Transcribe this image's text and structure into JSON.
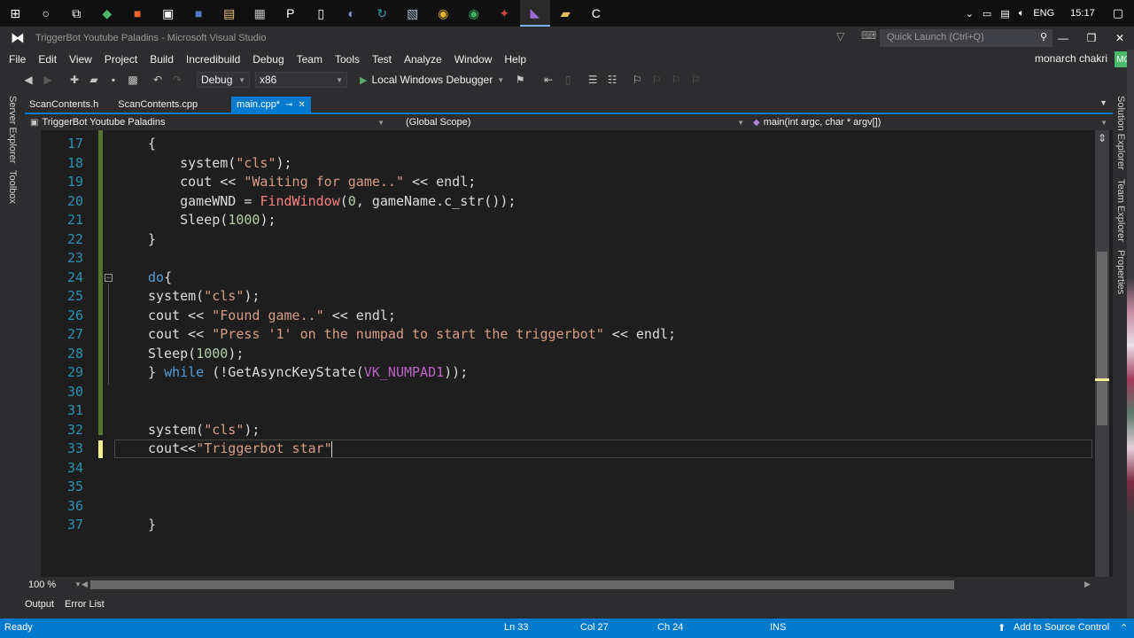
{
  "taskbar": {
    "time": "15:17",
    "language": "ENG",
    "apps": [
      {
        "icon": "windows-start-icon",
        "glyph": "⊞",
        "color": "#ffffff"
      },
      {
        "icon": "cortana-icon",
        "glyph": "○",
        "color": "#ffffff"
      },
      {
        "icon": "task-view-icon",
        "glyph": "⧉",
        "color": "#ffffff"
      },
      {
        "icon": "app-green-diamond-icon",
        "glyph": "◆",
        "color": "#4cb86c"
      },
      {
        "icon": "app-orange-icon",
        "glyph": "■",
        "color": "#e8672a"
      },
      {
        "icon": "store-icon",
        "glyph": "▣",
        "color": "#ffffff"
      },
      {
        "icon": "app-blue-icon",
        "glyph": "■",
        "color": "#5577cc"
      },
      {
        "icon": "app-image-icon",
        "glyph": "▤",
        "color": "#e8c070"
      },
      {
        "icon": "app-film-icon",
        "glyph": "▦",
        "color": "#c0c0c0"
      },
      {
        "icon": "app-p-icon",
        "glyph": "P",
        "color": "#ffffff"
      },
      {
        "icon": "app-doc-icon",
        "glyph": "▯",
        "color": "#ffffff"
      },
      {
        "icon": "app-disc-icon",
        "glyph": "◐",
        "color": "#8899cc"
      },
      {
        "icon": "app-refresh-icon",
        "glyph": "↻",
        "color": "#3aa0a0"
      },
      {
        "icon": "app-photos-icon",
        "glyph": "▧",
        "color": "#aabbcc"
      },
      {
        "icon": "chrome-icon",
        "glyph": "◉",
        "color": "#e0b030"
      },
      {
        "icon": "chrome-alt-icon",
        "glyph": "◉",
        "color": "#3ab060"
      },
      {
        "icon": "app-tool-icon",
        "glyph": "✦",
        "color": "#cc4444"
      },
      {
        "icon": "visual-studio-icon",
        "glyph": "◣",
        "color": "#9b6ad6"
      },
      {
        "icon": "file-explorer-icon",
        "glyph": "▰",
        "color": "#e8c060"
      },
      {
        "icon": "app-c-icon",
        "glyph": "C",
        "color": "#ffffff"
      }
    ]
  },
  "window": {
    "title": "TriggerBot Youtube Paladins - Microsoft Visual Studio",
    "quick_launch_placeholder": "Quick Launch (Ctrl+Q)"
  },
  "menu": {
    "items": [
      "File",
      "Edit",
      "View",
      "Project",
      "Build",
      "Incredibuild",
      "Debug",
      "Team",
      "Tools",
      "Test",
      "Analyze",
      "Window",
      "Help"
    ],
    "user": "monarch chakri",
    "user_initials": "MC"
  },
  "toolbar": {
    "config": "Debug",
    "platform": "x86",
    "debugger": "Local Windows Debugger"
  },
  "side_tabs": {
    "left": [
      "Server Explorer",
      "Toolbox"
    ],
    "right": [
      "Solution Explorer",
      "Team Explorer",
      "Properties"
    ]
  },
  "doc_tabs": [
    {
      "label": "ScanContents.h",
      "active": false
    },
    {
      "label": "ScanContents.cpp",
      "active": false
    },
    {
      "label": "main.cpp*",
      "active": true
    }
  ],
  "nav": {
    "project": "TriggerBot Youtube Paladins",
    "scope": "(Global Scope)",
    "member": "main(int argc, char * argv[])"
  },
  "editor": {
    "lines": [
      {
        "n": "17",
        "html": "{"
      },
      {
        "n": "18",
        "html": "    system(<span class='str'>\"cls\"</span>);"
      },
      {
        "n": "19",
        "html": "    cout &lt;&lt; <span class='str'>\"Waiting for game..\"</span> &lt;&lt; endl;"
      },
      {
        "n": "20",
        "html": "    gameWND = <span class='fn'>FindWindow</span>(<span class='num'>0</span>, gameName.c_str());"
      },
      {
        "n": "21",
        "html": "    Sleep(<span class='num'>1000</span>);"
      },
      {
        "n": "22",
        "html": "}"
      },
      {
        "n": "23",
        "html": ""
      },
      {
        "n": "24",
        "html": "<span class='kw'>do</span>{"
      },
      {
        "n": "25",
        "html": "system(<span class='str'>\"cls\"</span>);"
      },
      {
        "n": "26",
        "html": "cout &lt;&lt; <span class='str'>\"Found game..\"</span> &lt;&lt; endl;"
      },
      {
        "n": "27",
        "html": "cout &lt;&lt; <span class='str'>\"Press '1' on the numpad to start the triggerbot\"</span> &lt;&lt; endl;"
      },
      {
        "n": "28",
        "html": "Sleep(<span class='num'>1000</span>);"
      },
      {
        "n": "29",
        "html": "} <span class='kw'>while</span> (!GetAsyncKeyState(<span class='mac'>VK_NUMPAD1</span>));"
      },
      {
        "n": "30",
        "html": ""
      },
      {
        "n": "31",
        "html": ""
      },
      {
        "n": "32",
        "html": "system(<span class='str'>\"cls\"</span>);"
      },
      {
        "n": "33",
        "html": "cout&lt;&lt;<span class='str'>\"Triggerbot star\"</span>"
      },
      {
        "n": "34",
        "html": ""
      },
      {
        "n": "35",
        "html": ""
      },
      {
        "n": "36",
        "html": ""
      },
      {
        "n": "37",
        "html": "}"
      }
    ],
    "zoom": "100 %"
  },
  "bottom_tabs": [
    "Output",
    "Error List"
  ],
  "status": {
    "state": "Ready",
    "ln": "Ln 33",
    "col": "Col 27",
    "ch": "Ch 24",
    "mode": "INS",
    "source_control": "Add to Source Control"
  }
}
